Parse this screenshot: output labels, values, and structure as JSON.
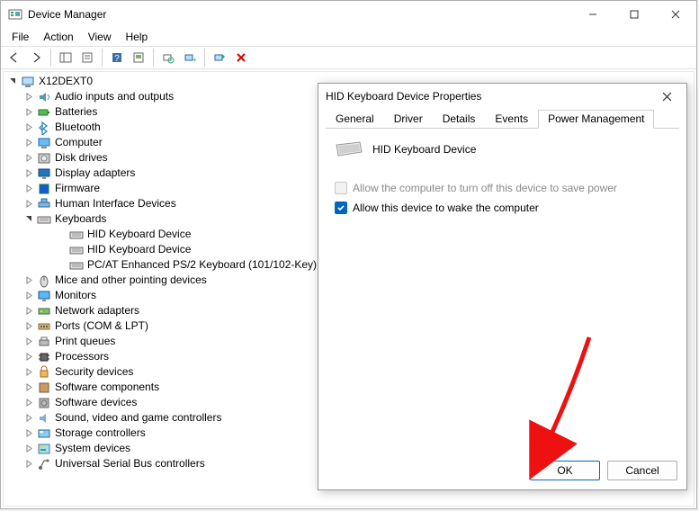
{
  "window": {
    "title": "Device Manager"
  },
  "menu": {
    "file": "File",
    "action": "Action",
    "view": "View",
    "help": "Help"
  },
  "tree": {
    "root": "X12DEXT0",
    "items": [
      {
        "label": "Audio inputs and outputs",
        "icon": "audio",
        "expandable": true
      },
      {
        "label": "Batteries",
        "icon": "battery",
        "expandable": true
      },
      {
        "label": "Bluetooth",
        "icon": "bluetooth",
        "expandable": true
      },
      {
        "label": "Computer",
        "icon": "computer",
        "expandable": true
      },
      {
        "label": "Disk drives",
        "icon": "disk",
        "expandable": true
      },
      {
        "label": "Display adapters",
        "icon": "display",
        "expandable": true
      },
      {
        "label": "Firmware",
        "icon": "firmware",
        "expandable": true
      },
      {
        "label": "Human Interface Devices",
        "icon": "hid",
        "expandable": true
      },
      {
        "label": "Keyboards",
        "icon": "keyboard",
        "expandable": true,
        "expanded": true,
        "children": [
          {
            "label": "HID Keyboard Device",
            "icon": "keyboard"
          },
          {
            "label": "HID Keyboard Device",
            "icon": "keyboard"
          },
          {
            "label": "PC/AT Enhanced PS/2 Keyboard (101/102-Key)",
            "icon": "keyboard"
          }
        ]
      },
      {
        "label": "Mice and other pointing devices",
        "icon": "mouse",
        "expandable": true
      },
      {
        "label": "Monitors",
        "icon": "monitor",
        "expandable": true
      },
      {
        "label": "Network adapters",
        "icon": "network",
        "expandable": true
      },
      {
        "label": "Ports (COM & LPT)",
        "icon": "port",
        "expandable": true
      },
      {
        "label": "Print queues",
        "icon": "printer",
        "expandable": true
      },
      {
        "label": "Processors",
        "icon": "cpu",
        "expandable": true
      },
      {
        "label": "Security devices",
        "icon": "security",
        "expandable": true
      },
      {
        "label": "Software components",
        "icon": "swc",
        "expandable": true
      },
      {
        "label": "Software devices",
        "icon": "swd",
        "expandable": true
      },
      {
        "label": "Sound, video and game controllers",
        "icon": "sound",
        "expandable": true
      },
      {
        "label": "Storage controllers",
        "icon": "storage",
        "expandable": true
      },
      {
        "label": "System devices",
        "icon": "system",
        "expandable": true
      },
      {
        "label": "Universal Serial Bus controllers",
        "icon": "usb",
        "expandable": true
      }
    ]
  },
  "dialog": {
    "title": "HID Keyboard Device Properties",
    "tabs": {
      "general": "General",
      "driver": "Driver",
      "details": "Details",
      "events": "Events",
      "power": "Power Management"
    },
    "device_name": "HID Keyboard Device",
    "checkbox1": "Allow the computer to turn off this device to save power",
    "checkbox2": "Allow this device to wake the computer",
    "cb1_checked": false,
    "cb1_enabled": false,
    "cb2_checked": true,
    "ok": "OK",
    "cancel": "Cancel"
  }
}
